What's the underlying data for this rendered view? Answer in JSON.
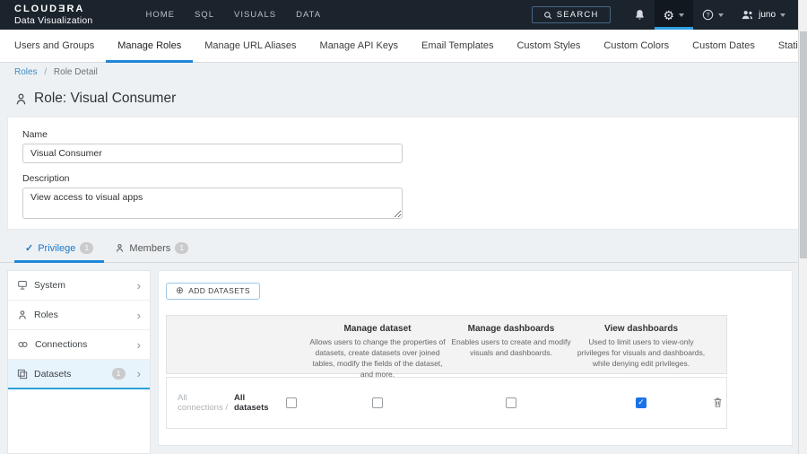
{
  "navbar": {
    "brand_line1": "CLOUDƎRA",
    "brand_line2": "Data Visualization",
    "links": [
      {
        "label": "HOME"
      },
      {
        "label": "SQL"
      },
      {
        "label": "VISUALS"
      },
      {
        "label": "DATA"
      }
    ],
    "search_label": "SEARCH",
    "user_name": "juno"
  },
  "admin_tabs": {
    "items": [
      {
        "label": "Users and Groups",
        "active": false
      },
      {
        "label": "Manage Roles",
        "active": true
      },
      {
        "label": "Manage URL Aliases",
        "active": false
      },
      {
        "label": "Manage API Keys",
        "active": false
      },
      {
        "label": "Email Templates",
        "active": false
      },
      {
        "label": "Custom Styles",
        "active": false
      },
      {
        "label": "Custom Colors",
        "active": false
      },
      {
        "label": "Custom Dates",
        "active": false
      },
      {
        "label": "Static Assets",
        "active": false
      }
    ]
  },
  "breadcrumb": {
    "link": "Roles",
    "separator": "/",
    "current": "Role Detail"
  },
  "page": {
    "title": "Role: Visual Consumer"
  },
  "form": {
    "name_label": "Name",
    "name_value": "Visual Consumer",
    "description_label": "Description",
    "description_value": "View access to visual apps"
  },
  "detail_tabs": {
    "privilege_label": "Privilege",
    "privilege_count": "1",
    "members_label": "Members",
    "members_count": "1"
  },
  "sidebar": {
    "items": [
      {
        "label": "System",
        "icon": "system-icon",
        "active": false
      },
      {
        "label": "Roles",
        "icon": "roles-icon",
        "active": false
      },
      {
        "label": "Connections",
        "icon": "connections-icon",
        "active": false
      },
      {
        "label": "Datasets",
        "icon": "datasets-icon",
        "count": "1",
        "active": true
      }
    ]
  },
  "privileges": {
    "add_button_label": "ADD DATASETS",
    "columns": [
      {
        "title": "Manage dataset",
        "description": "Allows users to change the properties of datasets, create datasets over joined tables, modify the fields of the dataset, and more."
      },
      {
        "title": "Manage dashboards",
        "description": "Enables users to create and modify visuals and dashboards."
      },
      {
        "title": "View dashboards",
        "description": "Used to limit users to view-only privileges for visuals and dashboards, while denying edit privileges."
      }
    ],
    "rows": [
      {
        "connection": "All connections /",
        "dataset": "All datasets",
        "selected": false,
        "checks": [
          false,
          false,
          true
        ]
      }
    ]
  },
  "colors": {
    "navbar_bg": "#1b232c",
    "accent_blue": "#1f87d8",
    "link_blue": "#3e8ec6",
    "checkbox_checked": "#1a73e8",
    "active_item_bg": "#e8f4fb",
    "badge_bg": "#c9cbcd"
  }
}
